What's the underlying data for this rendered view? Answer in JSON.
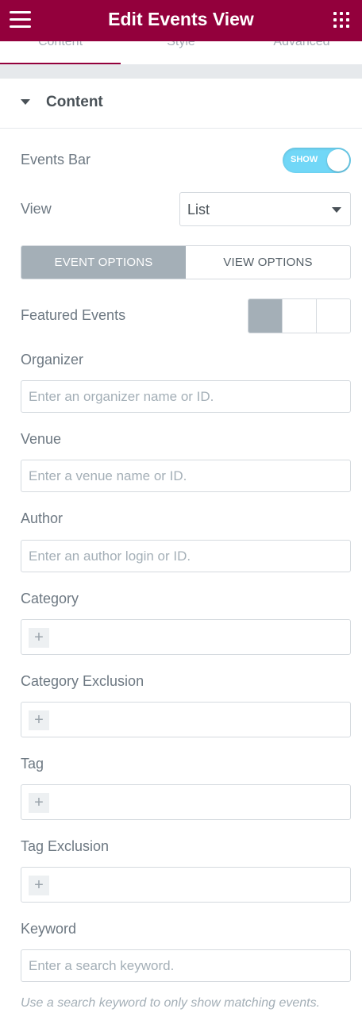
{
  "header": {
    "title": "Edit Events View"
  },
  "tabs": [
    {
      "label": "Content"
    },
    {
      "label": "Style"
    },
    {
      "label": "Advanced"
    }
  ],
  "section": {
    "title": "Content"
  },
  "events_bar": {
    "label": "Events Bar",
    "toggle_text": "SHOW"
  },
  "view": {
    "label": "View",
    "selected": "List"
  },
  "options_tabs": {
    "event": "EVENT OPTIONS",
    "view": "VIEW OPTIONS"
  },
  "featured": {
    "label": "Featured Events"
  },
  "organizer": {
    "label": "Organizer",
    "placeholder": "Enter an organizer name or ID."
  },
  "venue": {
    "label": "Venue",
    "placeholder": "Enter a venue name or ID."
  },
  "author": {
    "label": "Author",
    "placeholder": "Enter an author login or ID."
  },
  "category": {
    "label": "Category",
    "add": "+"
  },
  "category_exclusion": {
    "label": "Category Exclusion",
    "add": "+"
  },
  "tag": {
    "label": "Tag",
    "add": "+"
  },
  "tag_exclusion": {
    "label": "Tag Exclusion",
    "add": "+"
  },
  "keyword": {
    "label": "Keyword",
    "placeholder": "Enter a search keyword.",
    "help": "Use a search keyword to only show matching events."
  },
  "colors": {
    "header_bg": "#93003c",
    "toggle_on": "#71d7f7",
    "active_seg": "#a4afb7"
  }
}
